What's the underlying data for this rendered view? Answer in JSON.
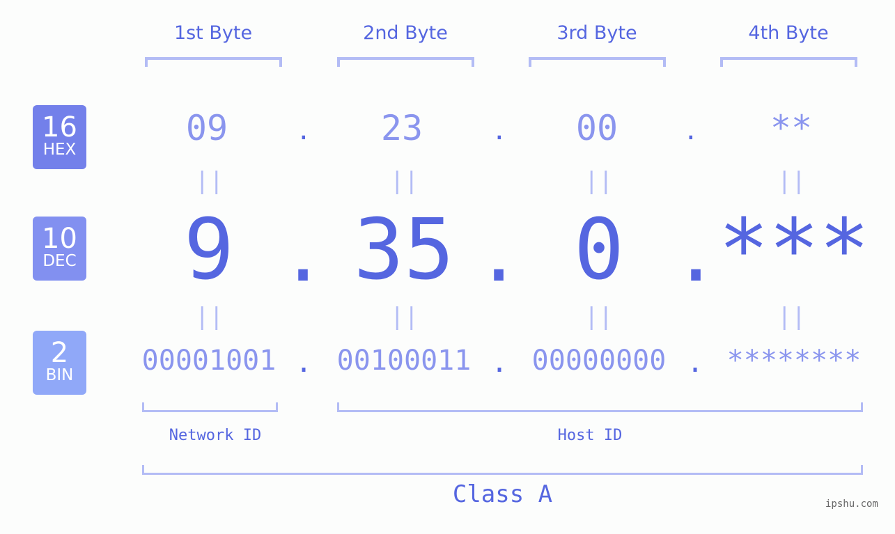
{
  "bytes": {
    "titles": [
      "1st Byte",
      "2nd Byte",
      "3rd Byte",
      "4th Byte"
    ]
  },
  "badges": {
    "hex": {
      "num": "16",
      "label": "HEX",
      "color": "#7380ea"
    },
    "dec": {
      "num": "10",
      "label": "DEC",
      "color": "#8290f0"
    },
    "bin": {
      "num": "2",
      "label": "BIN",
      "color": "#90a8f8"
    }
  },
  "values": {
    "hex": [
      "09",
      "23",
      "00",
      "**"
    ],
    "dec": [
      "9",
      "35",
      "0",
      "***"
    ],
    "bin": [
      "00001001",
      "00100011",
      "00000000",
      "********"
    ]
  },
  "separator": ".",
  "equals": "||",
  "labels": {
    "network_id": "Network ID",
    "host_id": "Host ID",
    "class": "Class A"
  },
  "watermark": "ipshu.com",
  "colors": {
    "accent": "#5566e0",
    "light": "#8a95ee",
    "bracket": "#b3bcf5"
  }
}
